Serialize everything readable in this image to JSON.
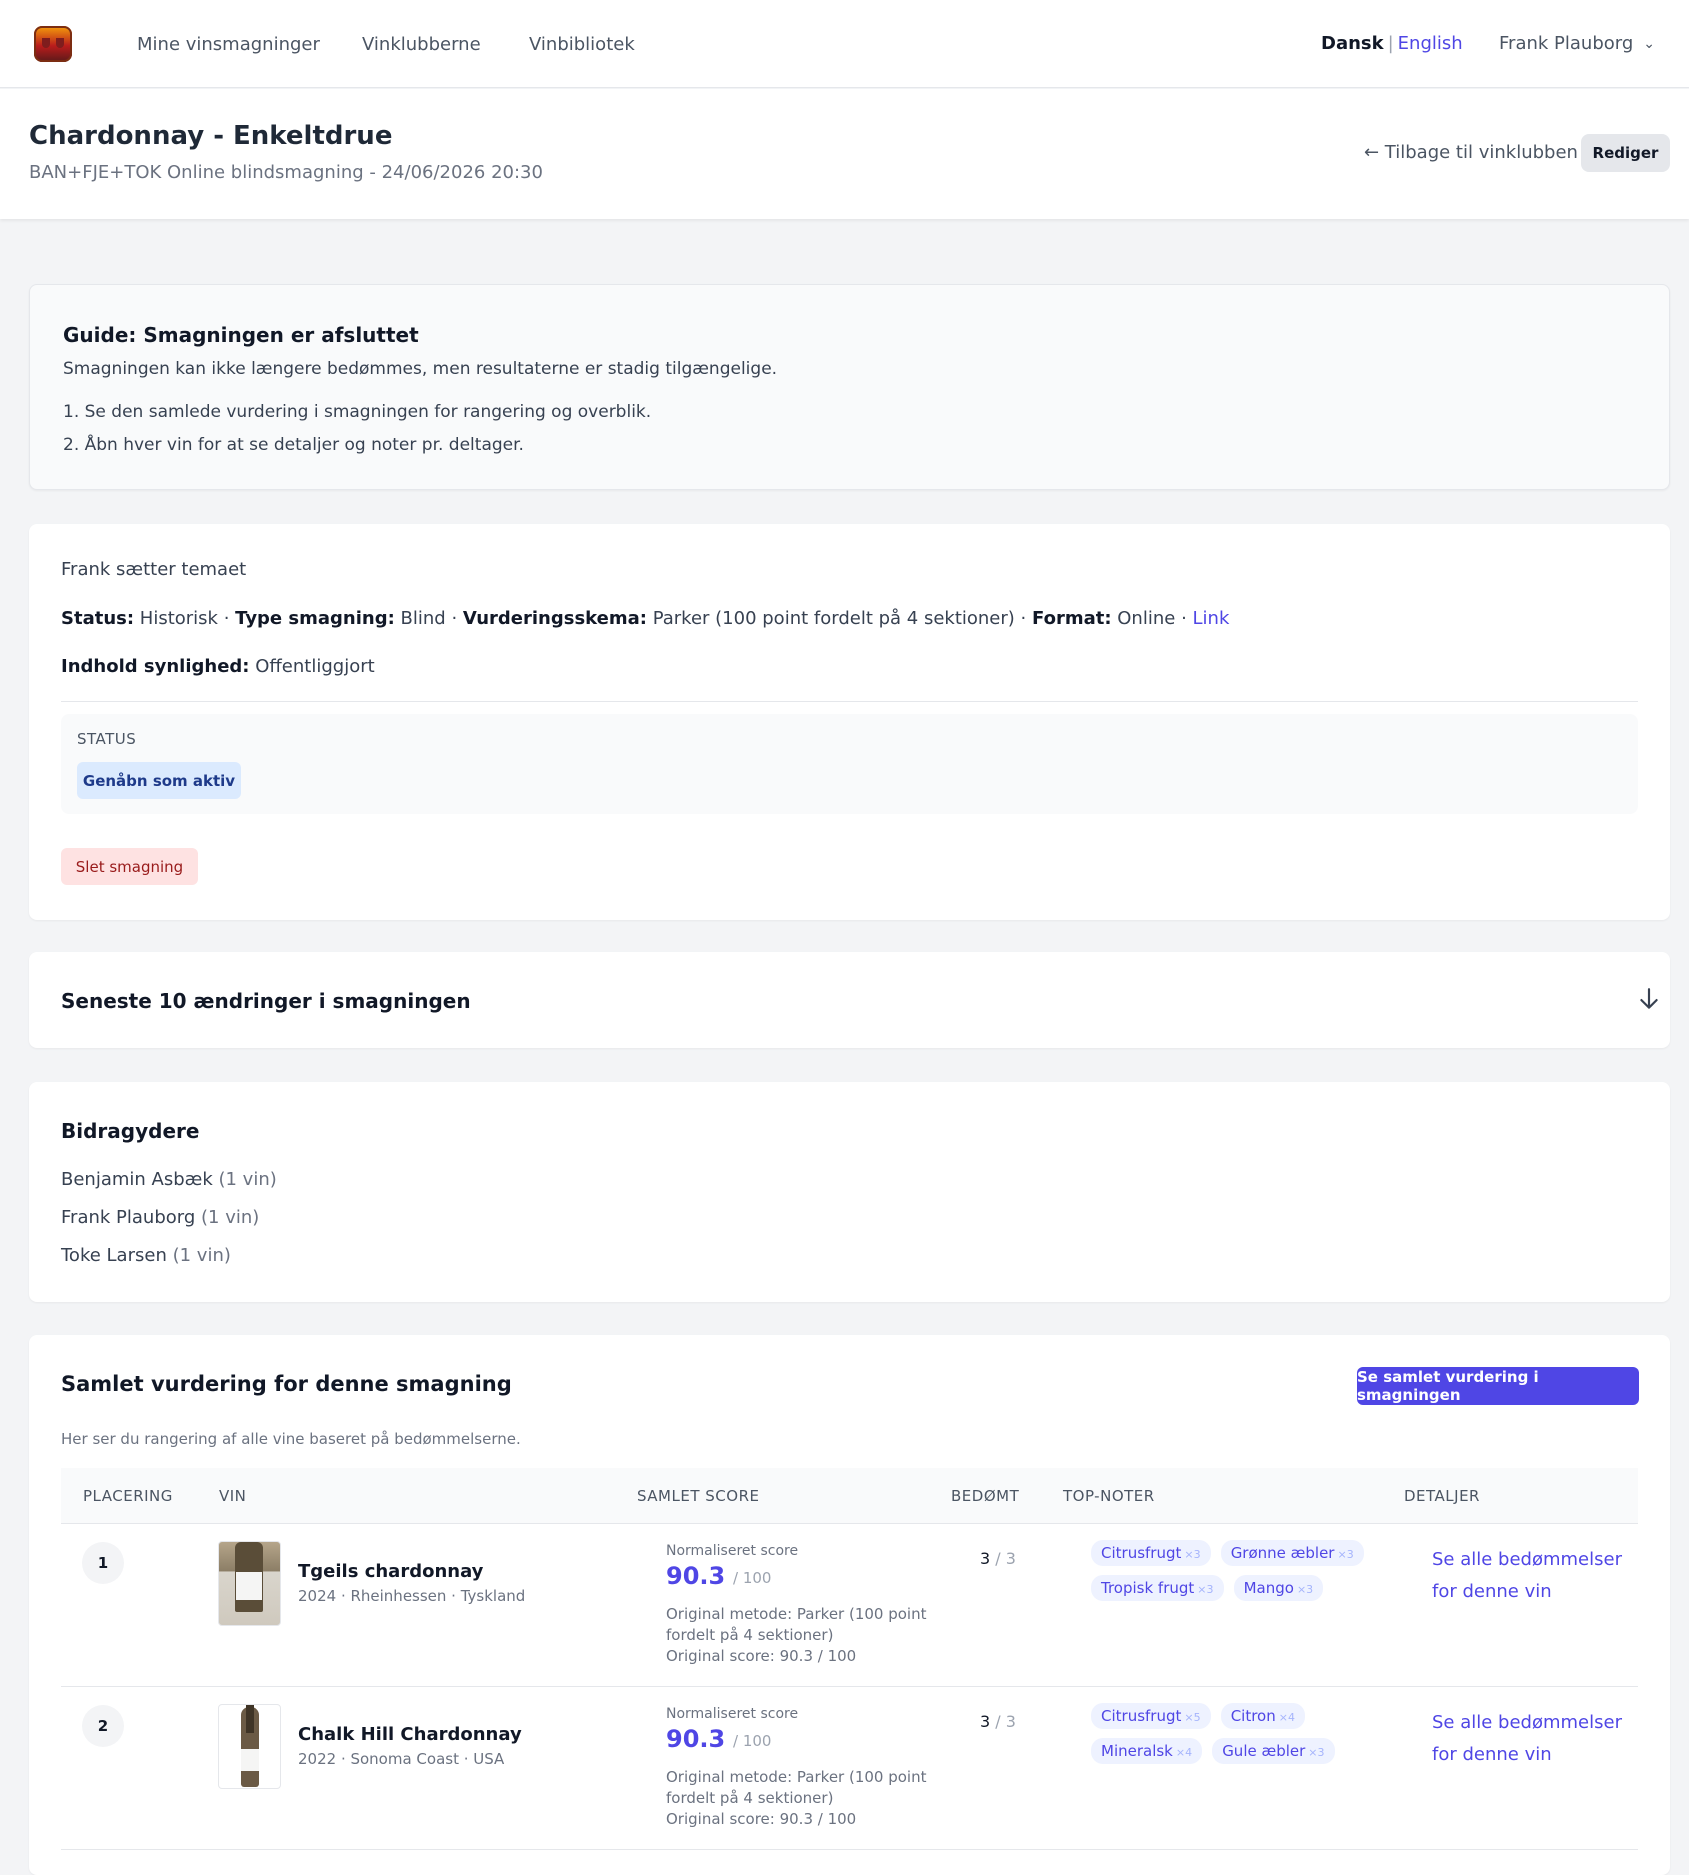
{
  "nav": {
    "links": [
      "Mine vinsmagninger",
      "Vinklubberne",
      "Vinbibliotek"
    ],
    "lang_active": "Dansk",
    "lang_sep": "|",
    "lang_other": "English",
    "user": "Frank Plauborg"
  },
  "header": {
    "title": "Chardonnay - Enkeltdrue",
    "subtitle": "BAN+FJE+TOK Online blindsmagning - 24/06/2026 20:30",
    "back": "← Tilbage til vinklubben",
    "edit": "Rediger"
  },
  "guide": {
    "title": "Guide: Smagningen er afsluttet",
    "text": "Smagningen kan ikke længere bedømmes, men resultaterne er stadig tilgængelige.",
    "steps": [
      "1. Se den samlede vurdering i smagningen for rangering og overblik.",
      "2. Åbn hver vin for at se detaljer og noter pr. deltager."
    ]
  },
  "info": {
    "theme": "Frank sætter temaet",
    "status_label": "Status:",
    "status_value": "Historisk",
    "type_label": "Type smagning:",
    "type_value": "Blind",
    "schema_label": "Vurderingsskema:",
    "schema_value": "Parker (100 point fordelt på 4 sektioner)",
    "format_label": "Format:",
    "format_value": "Online",
    "sep": "·",
    "link": "Link",
    "visibility_label": "Indhold synlighed:",
    "visibility_value": "Offentliggjort",
    "status_box_label": "STATUS",
    "reopen": "Genåbn som aktiv",
    "delete": "Slet smagning"
  },
  "changes": {
    "title": "Seneste 10 ændringer i smagningen"
  },
  "contributors": {
    "title": "Bidragydere",
    "items": [
      {
        "name": "Benjamin Asbæk",
        "count": "(1 vin)"
      },
      {
        "name": "Frank Plauborg",
        "count": "(1 vin)"
      },
      {
        "name": "Toke Larsen",
        "count": "(1 vin)"
      }
    ]
  },
  "summary": {
    "title": "Samlet vurdering for denne smagning",
    "button": "Se samlet vurdering i smagningen",
    "desc": "Her ser du rangering af alle vine baseret på bedømmelserne.",
    "columns": [
      "PLACERING",
      "VIN",
      "SAMLET SCORE",
      "BEDØMT",
      "TOP-NOTER",
      "DETALJER"
    ],
    "rows": [
      {
        "rank": "1",
        "name": "Tgeils chardonnay",
        "meta": "2024 · Rheinhessen · Tyskland",
        "norm_label": "Normaliseret score",
        "score": "90.3",
        "score_max": "/ 100",
        "orig_method": "Original metode: Parker (100 point fordelt på 4 sektioner)",
        "orig_score": "Original score: 90.3 / 100",
        "rated": "3",
        "rated_of": "/ 3",
        "notes": [
          {
            "label": "Citrusfrugt",
            "count": "×3"
          },
          {
            "label": "Grønne æbler",
            "count": "×3"
          },
          {
            "label": "Tropisk frugt",
            "count": "×3"
          },
          {
            "label": "Mango",
            "count": "×3"
          }
        ],
        "details": "Se alle bedømmelser for denne vin"
      },
      {
        "rank": "2",
        "name": "Chalk Hill Chardonnay",
        "meta": "2022 · Sonoma Coast · USA",
        "norm_label": "Normaliseret score",
        "score": "90.3",
        "score_max": "/ 100",
        "orig_method": "Original metode: Parker (100 point fordelt på 4 sektioner)",
        "orig_score": "Original score: 90.3 / 100",
        "rated": "3",
        "rated_of": "/ 3",
        "notes": [
          {
            "label": "Citrusfrugt",
            "count": "×5"
          },
          {
            "label": "Citron",
            "count": "×4"
          },
          {
            "label": "Mineralsk",
            "count": "×4"
          },
          {
            "label": "Gule æbler",
            "count": "×3"
          }
        ],
        "details": "Se alle bedømmelser for denne vin"
      }
    ]
  }
}
